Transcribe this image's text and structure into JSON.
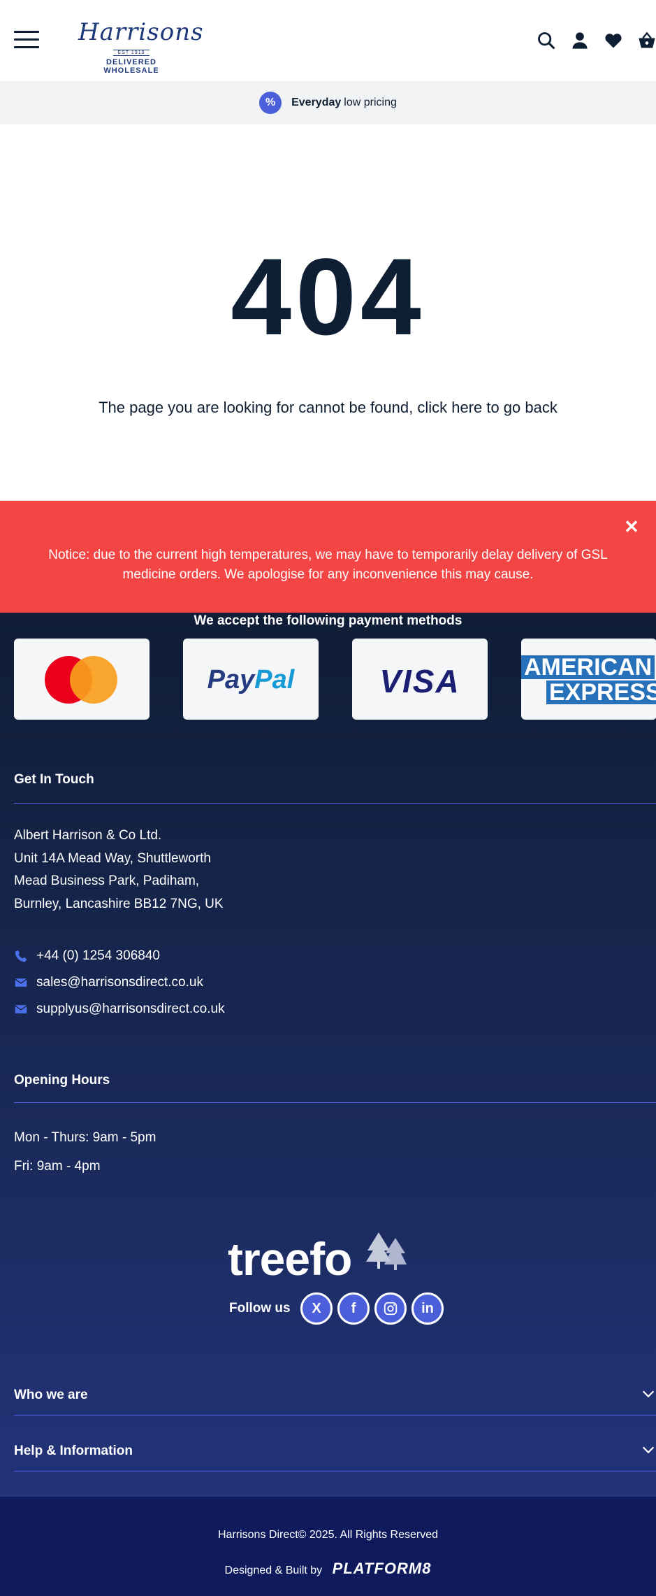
{
  "header": {
    "logo_script": "Harrisons",
    "logo_est": "EST 1919",
    "logo_tagline": "DELIVERED WHOLESALE",
    "icons": [
      "menu-icon",
      "search-icon",
      "user-icon",
      "heart-icon",
      "basket-icon"
    ]
  },
  "promo": {
    "strong": "Everyday",
    "rest": "low pricing",
    "badge_glyph": "%"
  },
  "error": {
    "code": "404",
    "message": "The page you are looking for cannot be found, click here to go back"
  },
  "notice": {
    "text": "Notice: due to the current high temperatures, we may have to temporarily delay delivery of GSL medicine orders. We apologise for any inconvenience this may cause.",
    "close_glyph": "✕",
    "color": "#f44545"
  },
  "payments": {
    "title": "We accept the following payment methods",
    "methods": [
      "Mastercard",
      "PayPal",
      "VISA",
      "American Express"
    ],
    "paypal_part1": "Pay",
    "paypal_part2": "Pal",
    "visa_text": "VISA",
    "amex_line1": "AMERICAN",
    "amex_line2": "EXPRESS"
  },
  "contact": {
    "title": "Get In Touch",
    "address": [
      "Albert Harrison & Co Ltd.",
      "Unit 14A Mead Way, Shuttleworth",
      "Mead Business Park, Padiham,",
      "Burnley, Lancashire BB12 7NG, UK"
    ],
    "phone": "+44 (0) 1254 306840",
    "email1": "sales@harrisonsdirect.co.uk",
    "email2": "supplyus@harrisonsdirect.co.uk"
  },
  "hours": {
    "title": "Opening Hours",
    "line1": "Mon - Thurs: 9am - 5pm",
    "line2": "Fri: 9am - 4pm"
  },
  "social": {
    "brand": "treefo",
    "follow_label": "Follow us",
    "networks": [
      "X",
      "f",
      "ig",
      "in"
    ]
  },
  "accordion": {
    "who": "Who we are",
    "help": "Help & Information"
  },
  "bottom": {
    "copyright": "Harrisons Direct© 2025. All Rights Reserved",
    "built_label": "Designed & Built by",
    "built_brand": "PLATFORM8"
  },
  "colors": {
    "navy": "#0f1f33",
    "accent": "#4a5fd9",
    "notice": "#f44545",
    "footer_bottom": "#0e1a5c"
  }
}
